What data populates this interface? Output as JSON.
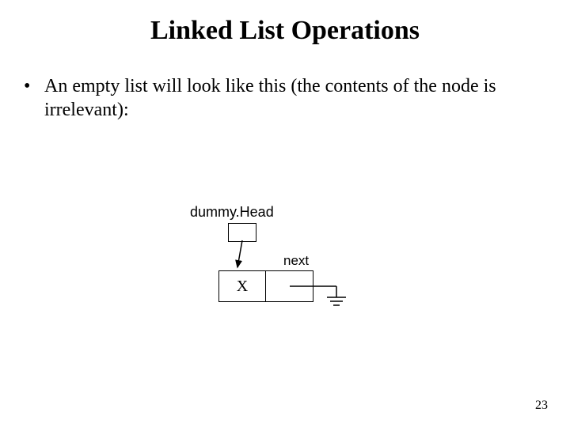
{
  "title": "Linked List Operations",
  "bullet": "An empty list will look like this (the contents of the node is irrelevant):",
  "diagram": {
    "dummyHeadLabel": "dummy.Head",
    "nextLabel": "next",
    "nodeValue": "X"
  },
  "pageNumber": "23"
}
